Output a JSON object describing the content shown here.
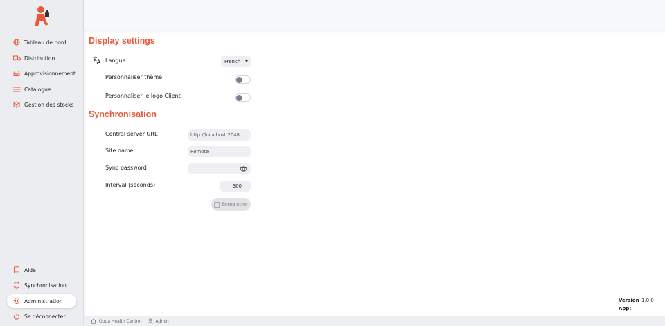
{
  "sidebar": {
    "items": [
      {
        "label": "Tableau de bord",
        "icon": "globe-icon"
      },
      {
        "label": "Distribution",
        "icon": "truck-icon"
      },
      {
        "label": "Approvisionnement",
        "icon": "inbox-icon"
      },
      {
        "label": "Catalogue",
        "icon": "list-icon"
      },
      {
        "label": "Gestion des stocks",
        "icon": "box-icon"
      }
    ],
    "bottom_items": [
      {
        "label": "Aide",
        "icon": "book-icon"
      },
      {
        "label": "Synchronisation",
        "icon": "sync-icon"
      },
      {
        "label": "Administration",
        "icon": "gear-icon",
        "active": true
      },
      {
        "label": "Se déconnecter",
        "icon": "power-icon"
      }
    ]
  },
  "display": {
    "title": "Display settings",
    "language_label": "Langue",
    "language_value": "French",
    "theme_label": "Personnaliser thème",
    "logo_label": "Personnaliser le logo Client"
  },
  "sync": {
    "title": "Synchronisation",
    "url_label": "Central server URL",
    "url_value": "http://localhost:2048",
    "site_label": "Site name",
    "site_value": "Remote",
    "password_label": "Sync password",
    "interval_label": "Interval (seconds)",
    "interval_value": "300",
    "save_label": "Enregistrer"
  },
  "version": {
    "label": "Version",
    "value": "1.0.0",
    "app_label": "App:"
  },
  "footer": {
    "store": "Opua Health Centre",
    "user": "Admin"
  },
  "colors": {
    "accent": "#e8583a",
    "sidebar_bg": "#ecedf1",
    "toggle_knob": "#7b7e94"
  }
}
